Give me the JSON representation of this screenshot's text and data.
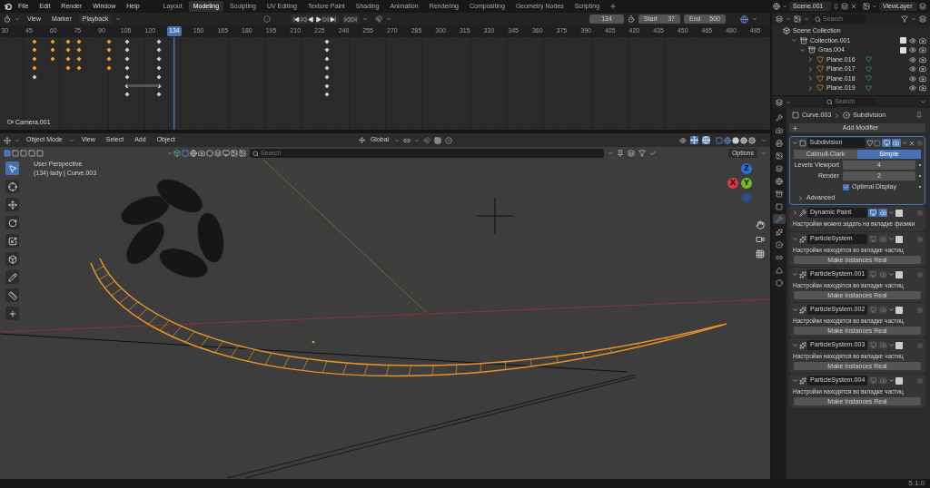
{
  "menu": [
    "File",
    "Edit",
    "Render",
    "Window",
    "Help"
  ],
  "workspaces": [
    {
      "label": "Layout",
      "selected": false
    },
    {
      "label": "Modeling",
      "selected": true
    },
    {
      "label": "Sculpting",
      "selected": false
    },
    {
      "label": "UV Editing",
      "selected": false
    },
    {
      "label": "Texture Paint",
      "selected": false
    },
    {
      "label": "Shading",
      "selected": false
    },
    {
      "label": "Animation",
      "selected": false
    },
    {
      "label": "Rendering",
      "selected": false
    },
    {
      "label": "Compositing",
      "selected": false
    },
    {
      "label": "Geometry Nodes",
      "selected": false
    },
    {
      "label": "Scripting",
      "selected": false
    }
  ],
  "scene": "Scene.001",
  "view_layer": "ViewLayer",
  "timeline": {
    "menus": [
      "View",
      "Marker"
    ],
    "playback": "Playback",
    "current_frame": "134",
    "start_label": "Start",
    "start": "37",
    "end_label": "End",
    "end": "500",
    "ruler": [
      {
        "label": "30",
        "selected": false
      },
      {
        "label": "45",
        "selected": false
      },
      {
        "label": "60",
        "selected": false
      },
      {
        "label": "75",
        "selected": false
      },
      {
        "label": "90",
        "selected": false
      },
      {
        "label": "105",
        "selected": false
      },
      {
        "label": "120",
        "selected": false
      },
      {
        "label": "134",
        "selected": true
      },
      {
        "label": "150",
        "selected": false
      },
      {
        "label": "165",
        "selected": false
      },
      {
        "label": "180",
        "selected": false
      },
      {
        "label": "195",
        "selected": false
      },
      {
        "label": "210",
        "selected": false
      },
      {
        "label": "225",
        "selected": false
      },
      {
        "label": "240",
        "selected": false
      },
      {
        "label": "255",
        "selected": false
      },
      {
        "label": "270",
        "selected": false
      },
      {
        "label": "285",
        "selected": false
      },
      {
        "label": "300",
        "selected": false
      },
      {
        "label": "315",
        "selected": false
      },
      {
        "label": "330",
        "selected": false
      },
      {
        "label": "345",
        "selected": false
      },
      {
        "label": "360",
        "selected": false
      },
      {
        "label": "375",
        "selected": false
      },
      {
        "label": "390",
        "selected": false
      },
      {
        "label": "405",
        "selected": false
      },
      {
        "label": "420",
        "selected": false
      },
      {
        "label": "435",
        "selected": false
      },
      {
        "label": "450",
        "selected": false
      },
      {
        "label": "465",
        "selected": false
      },
      {
        "label": "480",
        "selected": false
      },
      {
        "label": "495",
        "selected": false
      }
    ],
    "channel": "Camera.001"
  },
  "viewport": {
    "mode": "Object Mode",
    "menus": [
      "View",
      "Select",
      "Add",
      "Object"
    ],
    "orientation": "Global",
    "search_placeholder": "Search",
    "options": "Options",
    "perspective": "User Perspective",
    "object_info": "(134) lady | Curve.003",
    "gizmo": [
      "Z",
      "X",
      "Y"
    ],
    "tools": [
      {
        "kind": "select",
        "selected": true
      },
      {
        "kind": "cursor",
        "selected": false
      },
      {
        "kind": "move",
        "selected": false
      },
      {
        "kind": "rotate",
        "selected": false
      },
      {
        "kind": "scale",
        "selected": false
      },
      {
        "kind": "transform",
        "selected": false
      },
      {
        "kind": "annotate",
        "selected": false
      },
      {
        "kind": "measure",
        "selected": false
      },
      {
        "kind": "add",
        "selected": false
      }
    ]
  },
  "outliner": {
    "search_placeholder": "Search",
    "tree": [
      {
        "name": "Scene Collection",
        "kind": "scene",
        "children": [
          {
            "name": "Collection.001",
            "kind": "collection",
            "expanded": true,
            "checked": true,
            "children": [
              {
                "name": "Gras.004",
                "kind": "collection",
                "expanded": true,
                "checked": true,
                "children": [
                  {
                    "name": "Plane.016",
                    "kind": "object",
                    "expanded": false
                  },
                  {
                    "name": "Plane.017",
                    "kind": "object",
                    "expanded": false
                  },
                  {
                    "name": "Plane.018",
                    "kind": "object",
                    "expanded": false
                  },
                  {
                    "name": "Plane.019",
                    "kind": "object",
                    "expanded": false
                  }
                ]
              }
            ]
          }
        ]
      }
    ]
  },
  "properties": {
    "search_placeholder": "Search",
    "breadcrumb": [
      "Curve.003",
      "Subdivision"
    ],
    "add_modifier": "Add Modifier",
    "tabs": [
      {
        "kind": "tool",
        "selected": false
      },
      {
        "kind": "render",
        "selected": false
      },
      {
        "kind": "output",
        "selected": false
      },
      {
        "kind": "view_layer",
        "selected": false
      },
      {
        "kind": "scene",
        "selected": false
      },
      {
        "kind": "world",
        "selected": false
      },
      {
        "kind": "collection",
        "selected": false
      },
      {
        "kind": "object",
        "selected": false
      },
      {
        "kind": "modifier",
        "selected": true
      },
      {
        "kind": "particles",
        "selected": false
      },
      {
        "kind": "physics",
        "selected": false
      },
      {
        "kind": "constraints",
        "selected": false
      },
      {
        "kind": "data",
        "selected": false
      },
      {
        "kind": "material",
        "selected": false
      }
    ],
    "modifiers": [
      {
        "kind": "subdivision",
        "name": "Subdivision",
        "active": true,
        "expanded": true,
        "show_viewport": true,
        "show_render": true,
        "methods": [
          {
            "label": "Catmull-Clark",
            "selected": false
          },
          {
            "label": "Simple",
            "selected": true
          }
        ],
        "fields": [
          {
            "label": "Levels Viewport",
            "value": "4"
          },
          {
            "label": "Render",
            "value": "2"
          }
        ],
        "optimal_display": {
          "label": "Optimal Display",
          "checked": true
        },
        "advanced": "Advanced"
      },
      {
        "kind": "dynamic_paint",
        "name": "Dynamic Paint",
        "active": false,
        "expanded": false,
        "show_viewport": true,
        "show_render": true,
        "note": "Настройки можно задать на вкладке физики"
      },
      {
        "kind": "particles",
        "name": "ParticleSystem",
        "active": false,
        "expanded": true,
        "show_viewport": false,
        "show_render": false,
        "note": "Настройки находятся во вкладке частиц",
        "button": "Make Instances Real"
      },
      {
        "kind": "particles",
        "name": "ParticleSystem.001",
        "active": false,
        "expanded": true,
        "show_viewport": false,
        "show_render": false,
        "note": "Настройки находятся во вкладке частиц",
        "button": "Make Instances Real"
      },
      {
        "kind": "particles",
        "name": "ParticleSystem.002",
        "active": false,
        "expanded": true,
        "show_viewport": false,
        "show_render": false,
        "note": "Настройки находятся во вкладке частиц",
        "button": "Make Instances Real"
      },
      {
        "kind": "particles",
        "name": "ParticleSystem.003",
        "active": false,
        "expanded": true,
        "show_viewport": false,
        "show_render": false,
        "note": "Настройки находятся во вкладке частиц",
        "button": "Make Instances Real"
      },
      {
        "kind": "particles",
        "name": "ParticleSystem.004",
        "active": false,
        "expanded": true,
        "show_viewport": false,
        "show_render": false,
        "note": "Настройки находятся во вкладке частиц",
        "button": "Make Instances Real"
      }
    ]
  },
  "status": {
    "version": "5.1.0"
  }
}
